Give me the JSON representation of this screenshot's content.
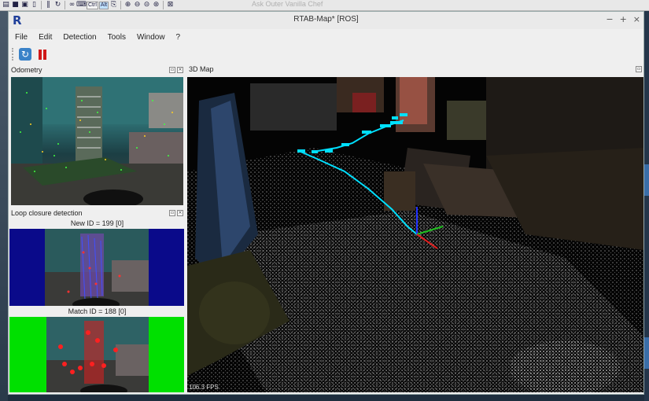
{
  "host_toolbar": {
    "ctrl_label": "Ctrl",
    "alt_label": "Alt",
    "ghost_title": "Ask Outer Vanilla Chef"
  },
  "window": {
    "title": "RTAB-Map* [ROS]",
    "logo": "R",
    "controls": [
      "−",
      "+",
      "×"
    ]
  },
  "menu": [
    "File",
    "Edit",
    "Detection",
    "Tools",
    "Window",
    "?"
  ],
  "toolbar": {
    "refresh_icon": "refresh-icon",
    "pause_icon": "pause-icon"
  },
  "docks": {
    "odometry": {
      "title": "Odometry"
    },
    "loop_closure": {
      "title": "Loop closure detection",
      "new_id_caption": "New ID = 199 [0]",
      "match_id_caption": "Match ID = 188 [0]"
    },
    "map3d": {
      "title": "3D Map",
      "fps": "106.3 FPS"
    }
  },
  "colors": {
    "new_image_border": "#0a0a8a",
    "match_image_border": "#00e000",
    "trajectory": "#00e0ff"
  }
}
